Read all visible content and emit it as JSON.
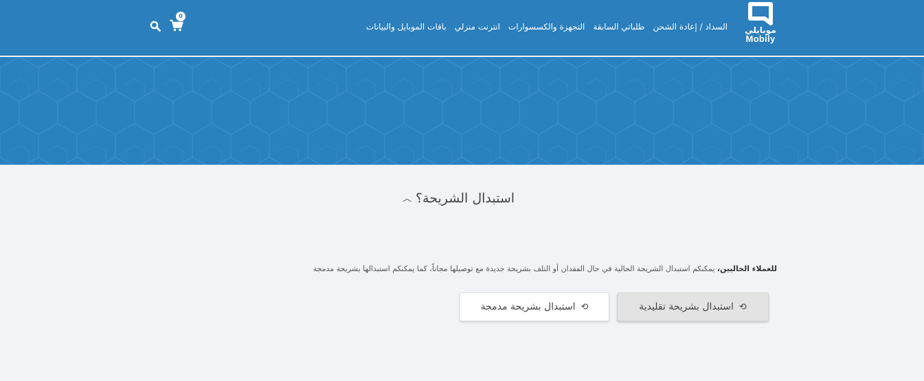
{
  "header": {
    "logo": {
      "ar": "موبايلي",
      "en": "Mobily"
    },
    "nav": [
      {
        "label": "باقات الموبايل والبيانات",
        "id": "mobile-plans"
      },
      {
        "label": "انترنت منزلي",
        "id": "home-internet"
      },
      {
        "label": "التجهزة والكسسوارات",
        "id": "devices"
      },
      {
        "label": "طلباتي السابقة",
        "id": "previous-orders"
      },
      {
        "label": "السداد / إعادة الشحن",
        "id": "pay-recharge"
      }
    ],
    "cart": {
      "count": "0"
    }
  },
  "faq": {
    "question": "استبدال الشريحة؟",
    "answer_bold": "للعملاء الحاليين،",
    "answer_text": " يمكنكم استبدال الشريحة الحالية في حال الفقدان أو التلف بشريحة جديدة مع توصيلها مجاناً، كما يمكنكم استبدالها بشريحة مدمجة",
    "buttons": {
      "physical": "استبدال بشريحة تقليدية",
      "esim": "استبدال بشريحة مدمجة"
    }
  },
  "colors": {
    "brand_blue": "#2a7fbc",
    "page_bg": "#f2f3f5"
  }
}
